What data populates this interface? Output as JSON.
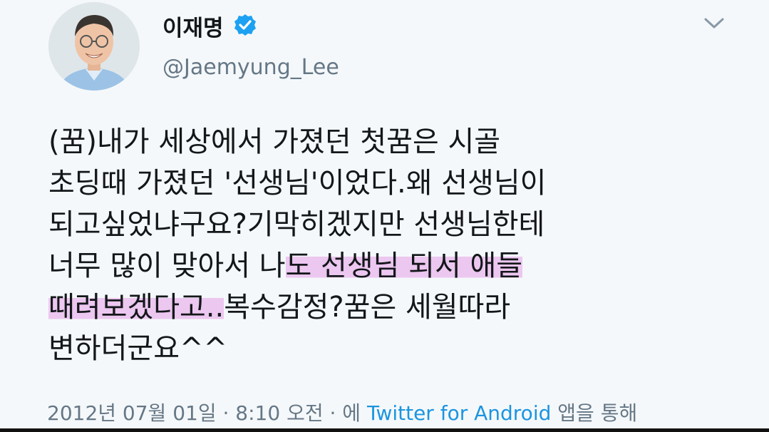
{
  "user": {
    "display_name": "이재명",
    "handle": "@Jaemyung_Lee",
    "verified": true
  },
  "tweet": {
    "lines": [
      {
        "parts": [
          {
            "text": "(꿈)내가 세상에서 가졌던 첫꿈은 시골",
            "highlight": false
          }
        ]
      },
      {
        "parts": [
          {
            "text": "초딩때 가졌던 '선생님'이었다.왜 선생님이",
            "highlight": false
          }
        ]
      },
      {
        "parts": [
          {
            "text": "되고싶었냐구요?기막히겠지만 선생님한테",
            "highlight": false
          }
        ]
      },
      {
        "parts": [
          {
            "text": "너무 많이 맞아서 나",
            "highlight": false
          },
          {
            "text": "도 선생님 되서 애들",
            "highlight": true
          }
        ]
      },
      {
        "parts": [
          {
            "text": "때려보겠다고..",
            "highlight": true
          },
          {
            "text": "복수감정?꿈은 세월따라",
            "highlight": false
          }
        ]
      },
      {
        "parts": [
          {
            "text": "변하더군요^^",
            "highlight": false
          }
        ]
      }
    ],
    "highlight_color": "#ecc7f0",
    "meta_prefix": "2012년 07월 01일 · 8:10 오전 · 에 ",
    "meta_app": "Twitter for Android",
    "meta_suffix": " 앱을 통해"
  },
  "icons": {
    "verified": "verified-badge-icon",
    "menu": "chevron-down-icon"
  },
  "colors": {
    "text": "#14171a",
    "secondary": "#657786",
    "link": "#1b95e0",
    "verified": "#1da1f2"
  }
}
